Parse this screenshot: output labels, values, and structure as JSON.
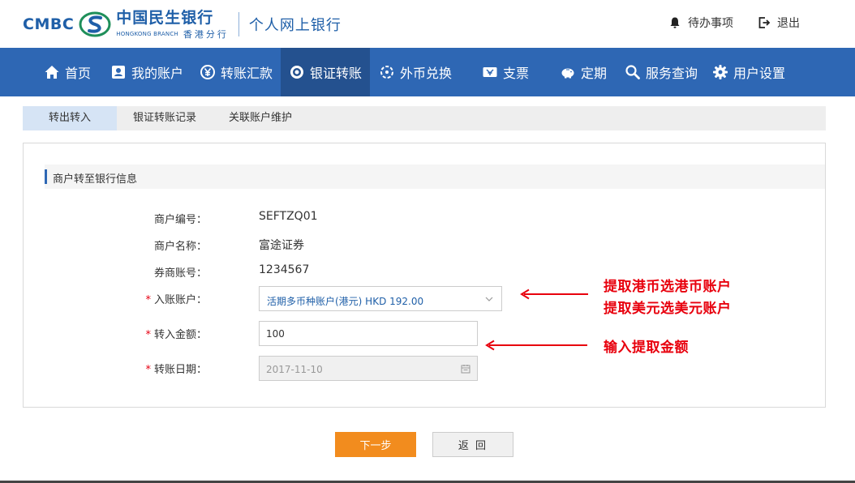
{
  "header": {
    "logo_cmbc": "CMBC",
    "logo_cn": "中国民生银行",
    "logo_en": "HONGKONG BRANCH",
    "logo_hk": "香港分行",
    "title": "个人网上银行",
    "todo_label": "待办事项",
    "logout_label": "退出"
  },
  "nav": {
    "items": [
      {
        "label": "首页",
        "icon": "home-icon"
      },
      {
        "label": "我的账户",
        "icon": "account-icon"
      },
      {
        "label": "转账汇款",
        "icon": "yen-icon"
      },
      {
        "label": "银证转账",
        "icon": "target-icon",
        "active": true
      },
      {
        "label": "外币兑换",
        "icon": "exchange-icon"
      },
      {
        "label": "支票",
        "icon": "cheque-icon"
      },
      {
        "label": "定期",
        "icon": "piggy-icon"
      },
      {
        "label": "服务查询",
        "icon": "search-icon"
      },
      {
        "label": "用户设置",
        "icon": "gear-icon"
      }
    ]
  },
  "tabs": [
    {
      "label": "转出转入",
      "active": true
    },
    {
      "label": "银证转账记录"
    },
    {
      "label": "关联账户维护"
    }
  ],
  "panel": {
    "title": "商户转至银行信息",
    "merchant_id_label": "商户编号：",
    "merchant_id_value": "SEFTZQ01",
    "merchant_name_label": "商户名称：",
    "merchant_name_value": "富途证券",
    "broker_account_label": "券商账号：",
    "broker_account_value": "1234567",
    "required_mark": "*",
    "deposit_account_label": "入账账户：",
    "deposit_account_value": "活期多币种账户(港元) HKD 192.00",
    "amount_label": "转入金额：",
    "amount_value": "100",
    "date_label": "转账日期：",
    "date_value": "2017-11-10"
  },
  "annotations": {
    "line1": "提取港币选港币账户",
    "line2": "提取美元选美元账户",
    "line3": "输入提取金额"
  },
  "buttons": {
    "next": "下一步",
    "back": "返 回"
  },
  "colors": {
    "nav_bg": "#2e67b4",
    "nav_active": "#24518f",
    "next_button": "#f28c1e",
    "annotation": "#e8000d"
  }
}
